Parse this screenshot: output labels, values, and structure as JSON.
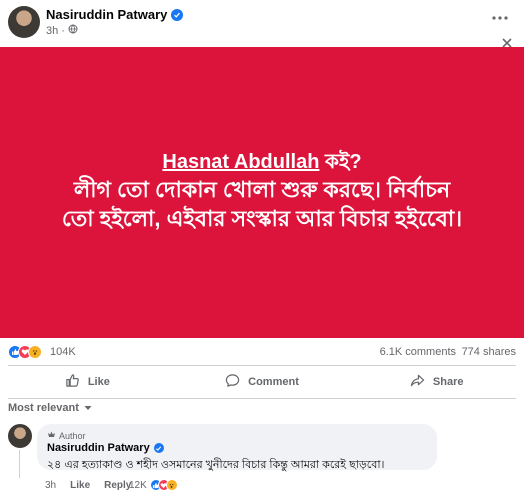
{
  "post": {
    "author": "Nasiruddin Patwary",
    "time": "3h",
    "banner_lines": {
      "link": "Hasnat Abdullah",
      "after_link": " কই?",
      "line2": "লীগ তো দোকান খোলা শুরু করছে। নির্বাচন",
      "line3": "তো হইলো, এইবার সংস্কার আর বিচার হইবেো।"
    },
    "banner_color": "#dc143c"
  },
  "stats": {
    "reactions": "104K",
    "comments": "6.1K comments",
    "shares": "774 shares"
  },
  "actions": {
    "like": "Like",
    "comment": "Comment",
    "share": "Share"
  },
  "sort": {
    "label": "Most relevant"
  },
  "comment": {
    "badge": "Author",
    "author": "Nasiruddin Patwary",
    "text": "২৪ এর হত্যাকাণ্ড ও শহীদ ওসমানের খুনীদের বিচার কিন্তু আমরা করেই ছাড়বো।",
    "time": "3h",
    "like": "Like",
    "reply": "Reply",
    "reactions": "12K"
  },
  "icons": [
    "globe-icon",
    "more-icon",
    "close-icon",
    "verified-icon",
    "like-icon",
    "comment-icon",
    "share-icon",
    "chevron-down-icon"
  ]
}
